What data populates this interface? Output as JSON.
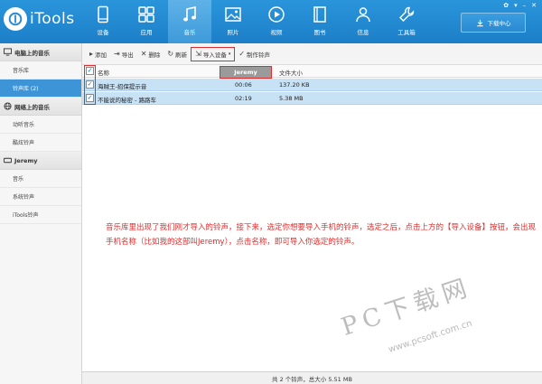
{
  "app": {
    "logo_text": "iTools"
  },
  "nav": [
    {
      "label": "设备",
      "icon": "phone-icon"
    },
    {
      "label": "应用",
      "icon": "apps-icon"
    },
    {
      "label": "音乐",
      "icon": "music-icon"
    },
    {
      "label": "照片",
      "icon": "photo-icon"
    },
    {
      "label": "视频",
      "icon": "video-icon"
    },
    {
      "label": "图书",
      "icon": "book-icon"
    },
    {
      "label": "信息",
      "icon": "person-icon"
    },
    {
      "label": "工具箱",
      "icon": "wrench-icon"
    }
  ],
  "download_center": {
    "label": "下载中心"
  },
  "sidebar": {
    "groups": [
      {
        "title": "电脑上的音乐",
        "items": [
          "音乐库",
          "铃声库 (2)"
        ]
      },
      {
        "title": "网络上的音乐",
        "items": [
          "动听音乐",
          "酷炫铃声"
        ]
      },
      {
        "title": "Jeremy",
        "items": [
          "音乐",
          "系统铃声",
          "iTools铃声"
        ]
      }
    ]
  },
  "toolbar": {
    "add": "添加",
    "export": "导出",
    "delete": "删除",
    "refresh": "刷新",
    "import_device": "导入设备",
    "make_ringtone": "制作铃声"
  },
  "device_popup": "Jeremy",
  "table": {
    "columns": {
      "name": "名称",
      "size": "文件大小"
    },
    "rows": [
      {
        "name": "海贼王-招保提示音",
        "duration": "00:06",
        "size": "137.20 KB"
      },
      {
        "name": "不能说的秘密 - 路路车",
        "duration": "02:19",
        "size": "5.38 MB"
      }
    ]
  },
  "annotation": "音乐库里出现了我们刚才导入的铃声，接下来，选定你想要导入手机的铃声，选定之后，点击上方的【导入设备】按钮，会出现手机名称（比如我的这部叫Jeremy），点击名称，即可导入你选定的铃声。",
  "watermark": {
    "brand": "PC下载网",
    "url": "www.pcsoft.com.cn"
  },
  "status_bar": "共 2 个铃声，总大小 5.51 MB"
}
